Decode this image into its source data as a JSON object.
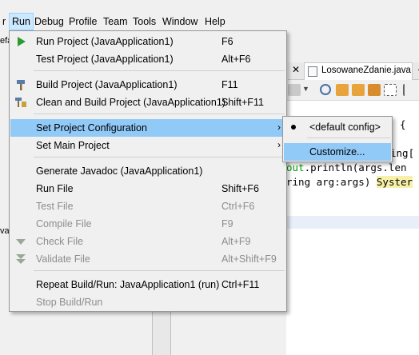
{
  "menubar": {
    "partial_left": "r",
    "items": [
      "Run",
      "Debug",
      "Profile",
      "Team",
      "Tools",
      "Window",
      "Help"
    ]
  },
  "background": {
    "left_partial_1": "efa",
    "left_partial_2": "va",
    "tab_close": "✕",
    "file_tab": "LosowaneZdanie.java",
    "tab_arrow": "▲",
    "code": [
      {
        "text": "{",
        "line": 0
      },
      {
        "pre": "ing[",
        "line": 1
      },
      {
        "field": "out",
        "rest": ".println(args.len",
        "line": 2
      },
      {
        "pre": "ring arg:args) ",
        "hl": "Syster",
        "line": 3
      }
    ]
  },
  "run_menu": {
    "items": [
      {
        "label": "Run Project (JavaApplication1)",
        "shortcut": "F6",
        "icon": "run-project-icon",
        "disabled": false
      },
      {
        "label": "Test Project (JavaApplication1)",
        "shortcut": "Alt+F6",
        "icon": "",
        "disabled": false
      },
      {
        "label": "Build Project (JavaApplication1)",
        "shortcut": "F11",
        "icon": "build-hammer-icon",
        "disabled": false
      },
      {
        "label": "Clean and Build Project (JavaApplication1)",
        "shortcut": "Shift+F11",
        "icon": "clean-build-icon",
        "disabled": false
      },
      {
        "label": "Set Project Configuration",
        "shortcut": "",
        "icon": "",
        "disabled": false,
        "submenu": true,
        "selected": true
      },
      {
        "label": "Set Main Project",
        "shortcut": "",
        "icon": "",
        "disabled": false,
        "submenu": true
      },
      {
        "label": "Generate Javadoc (JavaApplication1)",
        "shortcut": "",
        "icon": "",
        "disabled": false
      },
      {
        "label": "Run File",
        "shortcut": "Shift+F6",
        "icon": "",
        "disabled": false
      },
      {
        "label": "Test File",
        "shortcut": "Ctrl+F6",
        "icon": "",
        "disabled": true
      },
      {
        "label": "Compile File",
        "shortcut": "F9",
        "icon": "",
        "disabled": true
      },
      {
        "label": "Check File",
        "shortcut": "Alt+F9",
        "icon": "check-file-icon",
        "disabled": true
      },
      {
        "label": "Validate File",
        "shortcut": "Alt+Shift+F9",
        "icon": "validate-file-icon",
        "disabled": true
      },
      {
        "label": "Repeat Build/Run: JavaApplication1 (run)",
        "shortcut": "Ctrl+F11",
        "icon": "",
        "disabled": false
      },
      {
        "label": "Stop Build/Run",
        "shortcut": "",
        "icon": "",
        "disabled": true
      }
    ]
  },
  "config_submenu": {
    "items": [
      {
        "label": "<default config>",
        "selected_radio": true
      },
      {
        "label": "Customize...",
        "highlighted": true
      }
    ]
  },
  "colors": {
    "menu_bg": "#f0f0f0",
    "highlight": "#91c9f7",
    "disabled_text": "#8d8d8d",
    "run_green": "#2e9a2e"
  }
}
